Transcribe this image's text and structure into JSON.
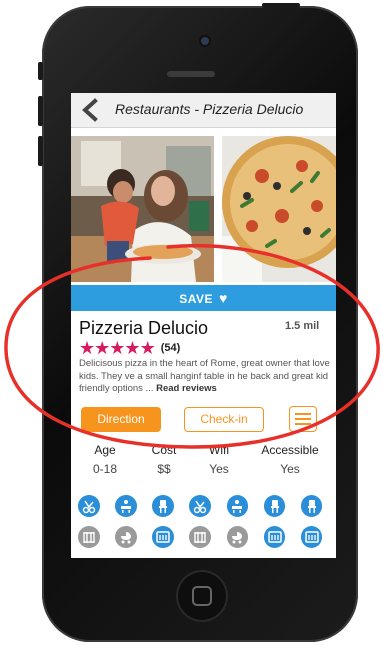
{
  "header": {
    "title": "Restaurants -  Pizzeria Delucio"
  },
  "save": {
    "label": "SAVE"
  },
  "restaurant": {
    "name": "Pizzeria Delucio",
    "distance": "1.5 mil",
    "rating": 5,
    "review_count": "(54)",
    "description": "Delicisous pizza in the heart of Rome, great owner that love kids. They ve a small hanginf table in he back and great kid friendly options ... ",
    "read_reviews": "Read reviews"
  },
  "actions": {
    "direction": "Direction",
    "checkin": "Check-in"
  },
  "stats": [
    {
      "label": "Age",
      "value": "0-18"
    },
    {
      "label": "Cost",
      "value": "$$"
    },
    {
      "label": "Wifi",
      "value": "Yes"
    },
    {
      "label": "Accessible",
      "value": "Yes"
    }
  ],
  "amenity_icons_row1": [
    "stroller-icon",
    "changing-table-icon",
    "high-chair-icon",
    "stroller-icon",
    "changing-table-icon",
    "high-chair-icon",
    "high-chair-icon"
  ],
  "amenity_icons_row2": [
    "crib-icon",
    "baby-carriage-icon",
    "kids-menu-icon",
    "crib-icon",
    "baby-carriage-icon",
    "kids-menu-icon",
    "kids-menu-icon"
  ],
  "colors": {
    "accent_orange": "#f7941d",
    "save_blue": "#2e9de0",
    "star_pink": "#d81b60",
    "icon_blue": "#2a8fd8",
    "annotation_red": "#e8302a"
  }
}
